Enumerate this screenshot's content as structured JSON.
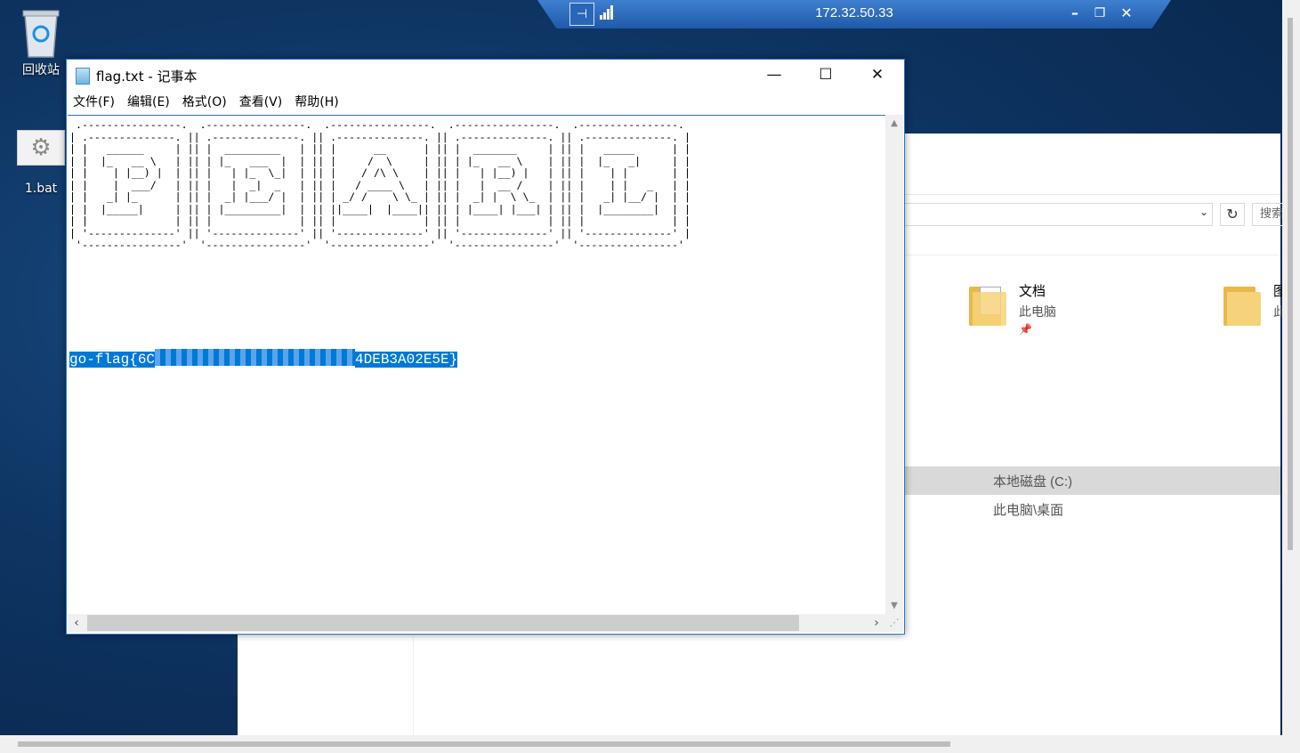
{
  "desktop": {
    "icons": [
      {
        "label": "回收站"
      },
      {
        "label": "1.bat"
      }
    ]
  },
  "rdp_bar": {
    "host": "172.32.50.33"
  },
  "notepad": {
    "title": "flag.txt - 记事本",
    "menu": [
      "文件(F)",
      "编辑(E)",
      "格式(O)",
      "查看(V)",
      "帮助(H)"
    ],
    "ascii_art": " .----------------.  .----------------.  .----------------.  .----------------.  .----------------.\n| .--------------. || .--------------. || .--------------. || .--------------. || .--------------. |\n| |   ______     | || |  _________   | || |      __      | || |  _______     | || |   _____      | |\n| |  |_   __ \\   | || | |_   ___  |  | || |     /  \\     | || | |_   __ \\    | || |  |_   _|     | |\n| |    | |__) |  | || |   | |_  \\_|  | || |    / /\\ \\    | || |   | |__) |   | || |    | |       | |\n| |    |  ___/   | || |   |  _|  _   | || |   / ____ \\   | || |   |  __ /    | || |    | |   _   | |\n| |   _| |_      | || |  _| |___/ |  | || | _/ /    \\ \\_ | || |  _| |  \\ \\_  | || |   _| |__/ |  | |\n| |  |_____|     | || | |_________|  | || ||____|  |____|| || | |____| |___| | || |  |________|  | |\n| |              | || |              | || |              | || |              | || |              | |\n| '--------------' || '--------------' || '--------------' || '--------------' || '--------------' |\n '----------------'  '----------------'  '----------------'  '----------------'  '----------------'",
    "flag_prefix": "go-flag{6C",
    "flag_suffix": "4DEB3A02E5E}"
  },
  "explorer": {
    "quick_access": [
      {
        "name": "文档",
        "location": "此电脑"
      },
      {
        "name": "图",
        "location": "此"
      }
    ],
    "search_placeholder": "搜索",
    "recent": [
      {
        "location": "本地磁盘 (C:)"
      },
      {
        "location": "此电脑\\桌面"
      }
    ]
  },
  "colors": {
    "desktop": "#0e3563",
    "selection": "#0078d7",
    "window_border": "#2b78d0",
    "rdp_bar": "#2a66b8"
  }
}
